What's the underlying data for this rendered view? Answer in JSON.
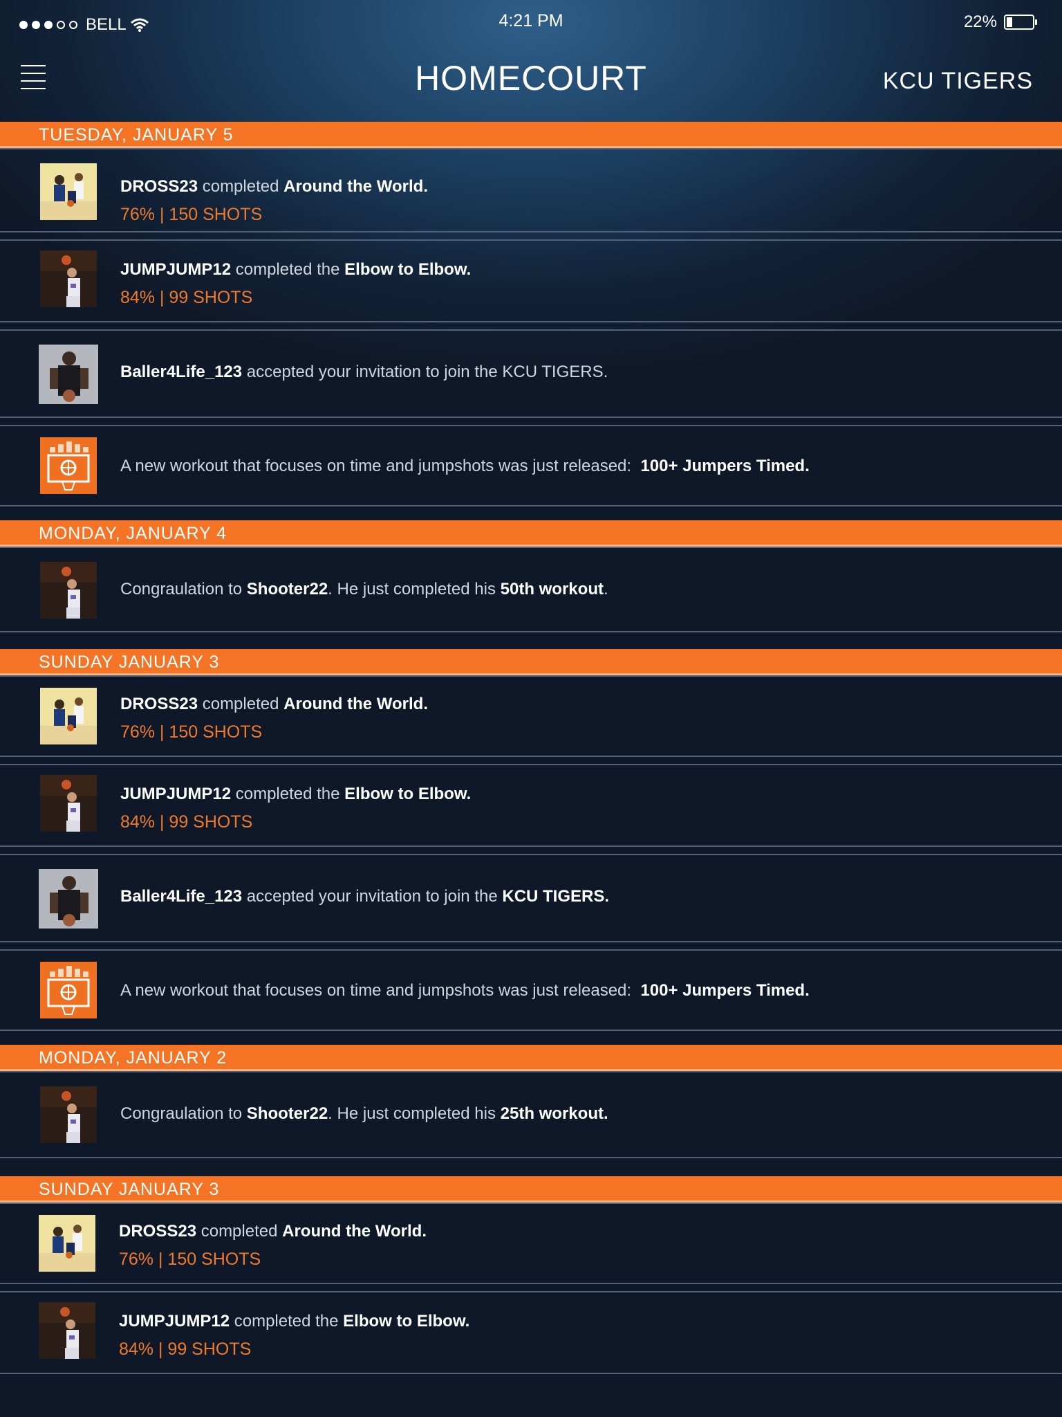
{
  "status": {
    "carrier": "BELL",
    "time": "4:21 PM",
    "battery": "22%",
    "battery_level": 0.22
  },
  "header": {
    "title": "HOMECOURT",
    "team": "KCU TIGERS"
  },
  "feed": {
    "d1": "TUESDAY, JANUARY 5",
    "d2": "MONDAY, JANUARY 4",
    "d3": "SUNDAY JANUARY 3",
    "d4": "MONDAY, JANUARY 2",
    "d5": "SUNDAY JANUARY 3",
    "words": {
      "completed": "completed",
      "completed_the": "completed the",
      "accepted": "accepted your invitation to join the",
      "new_workout": "A new workout that focuses on time and jumpshots was just released:",
      "congrats": "Congraulation to",
      "just_completed": ". He just completed his",
      "period": "."
    },
    "names": {
      "dross": "DROSS23",
      "jump": "JUMPJUMP12",
      "baller": "Baller4Life_123",
      "shooter": "Shooter22"
    },
    "workouts": {
      "atw": "Around the World.",
      "e2e": "Elbow to Elbow.",
      "timed": "100+ Jumpers Timed.",
      "w50": "50th workout",
      "w25": "25th workout."
    },
    "teams": {
      "plain": "KCU TIGERS.",
      "bold": "KCU TIGERS."
    },
    "stats": {
      "atw_wide": "76%   |   150 SHOTS",
      "atw": "76%  |  150 SHOTS",
      "e2e": "84%  |  99 SHOTS"
    },
    "icons": {
      "workout": "workout-icon"
    }
  }
}
